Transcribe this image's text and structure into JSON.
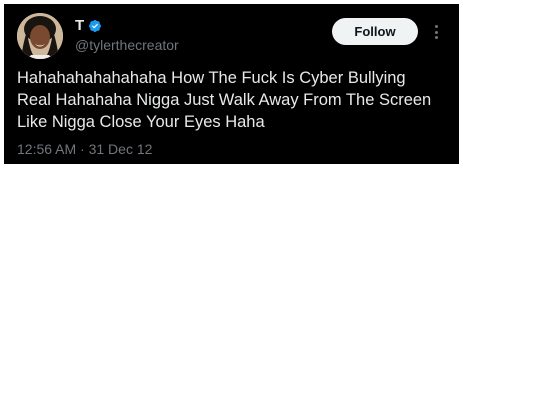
{
  "tweet": {
    "author": {
      "display_name": "T",
      "handle": "@tylerthecreator",
      "verified": true,
      "avatar_icon": "profile-photo"
    },
    "follow_label": "Follow",
    "more_icon": "vertical-ellipsis-icon",
    "text_lines": [
      "Hahahahahahahaha How The Fuck Is Cyber Bullying",
      "Real Hahahaha Nigga Just Walk Away From The Screen",
      "Like Nigga Close Your Eyes Haha"
    ],
    "timestamp": "12:56 AM · 31 Dec 12"
  },
  "colors": {
    "card_background": "#000000",
    "primary_text": "#e7e9ea",
    "secondary_text": "#71767b",
    "verified_blue": "#1d9bf0",
    "follow_button_bg": "#eff3f4",
    "follow_button_text": "#0f1419"
  }
}
